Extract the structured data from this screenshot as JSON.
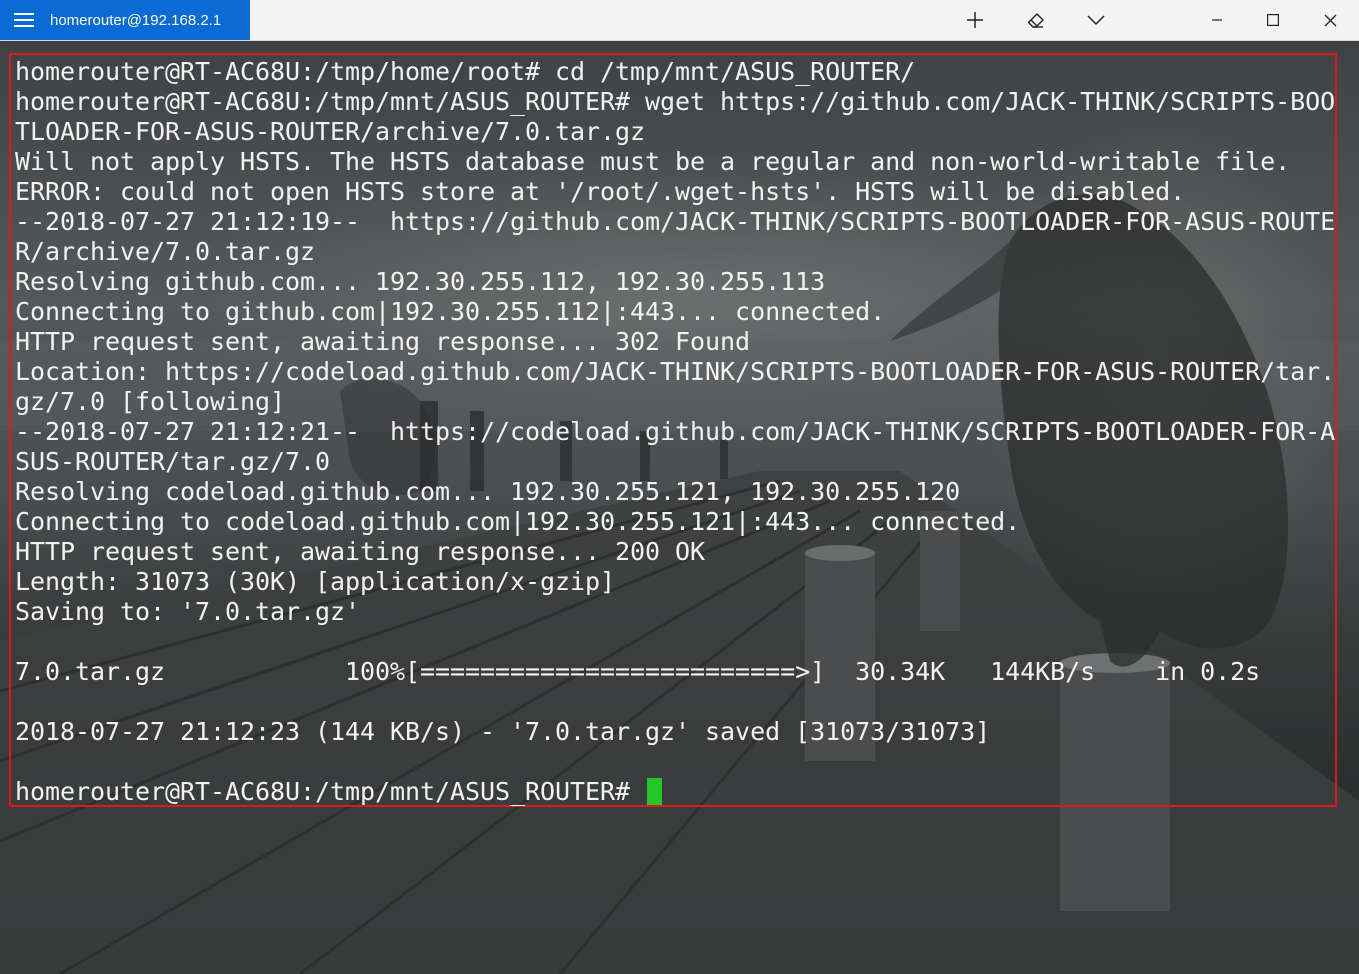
{
  "window": {
    "tab_title": "homerouter@192.168.2.1",
    "accent_color": "#0a6ad6"
  },
  "titlebar": {
    "menu_icon": "hamburger-icon",
    "buttons": [
      {
        "name": "new-tab",
        "icon": "plus-icon"
      },
      {
        "name": "clear",
        "icon": "eraser-icon"
      },
      {
        "name": "more-options",
        "icon": "chevron-down-icon"
      },
      {
        "name": "minimize",
        "icon": "minimize-icon"
      },
      {
        "name": "maximize",
        "icon": "maximize-icon"
      },
      {
        "name": "close",
        "icon": "close-icon"
      }
    ]
  },
  "terminal": {
    "highlight_color": "#e0181e",
    "cursor_color": "#22c82a",
    "lines": [
      "homerouter@RT-AC68U:/tmp/home/root# cd /tmp/mnt/ASUS_ROUTER/",
      "homerouter@RT-AC68U:/tmp/mnt/ASUS_ROUTER# wget https://github.com/JACK-THINK/SCRIPTS-BOO",
      "TLOADER-FOR-ASUS-ROUTER/archive/7.0.tar.gz",
      "Will not apply HSTS. The HSTS database must be a regular and non-world-writable file.",
      "ERROR: could not open HSTS store at '/root/.wget-hsts'. HSTS will be disabled.",
      "--2018-07-27 21:12:19--  https://github.com/JACK-THINK/SCRIPTS-BOOTLOADER-FOR-ASUS-ROUTE",
      "R/archive/7.0.tar.gz",
      "Resolving github.com... 192.30.255.112, 192.30.255.113",
      "Connecting to github.com|192.30.255.112|:443... connected.",
      "HTTP request sent, awaiting response... 302 Found",
      "Location: https://codeload.github.com/JACK-THINK/SCRIPTS-BOOTLOADER-FOR-ASUS-ROUTER/tar.",
      "gz/7.0 [following]",
      "--2018-07-27 21:12:21--  https://codeload.github.com/JACK-THINK/SCRIPTS-BOOTLOADER-FOR-A",
      "SUS-ROUTER/tar.gz/7.0",
      "Resolving codeload.github.com... 192.30.255.121, 192.30.255.120",
      "Connecting to codeload.github.com|192.30.255.121|:443... connected.",
      "HTTP request sent, awaiting response... 200 OK",
      "Length: 31073 (30K) [application/x-gzip]",
      "Saving to: '7.0.tar.gz'",
      "",
      "7.0.tar.gz            100%[=========================>]  30.34K   144KB/s    in 0.2s",
      "",
      "2018-07-27 21:12:23 (144 KB/s) - '7.0.tar.gz' saved [31073/31073]",
      "",
      "homerouter@RT-AC68U:/tmp/mnt/ASUS_ROUTER# "
    ]
  }
}
